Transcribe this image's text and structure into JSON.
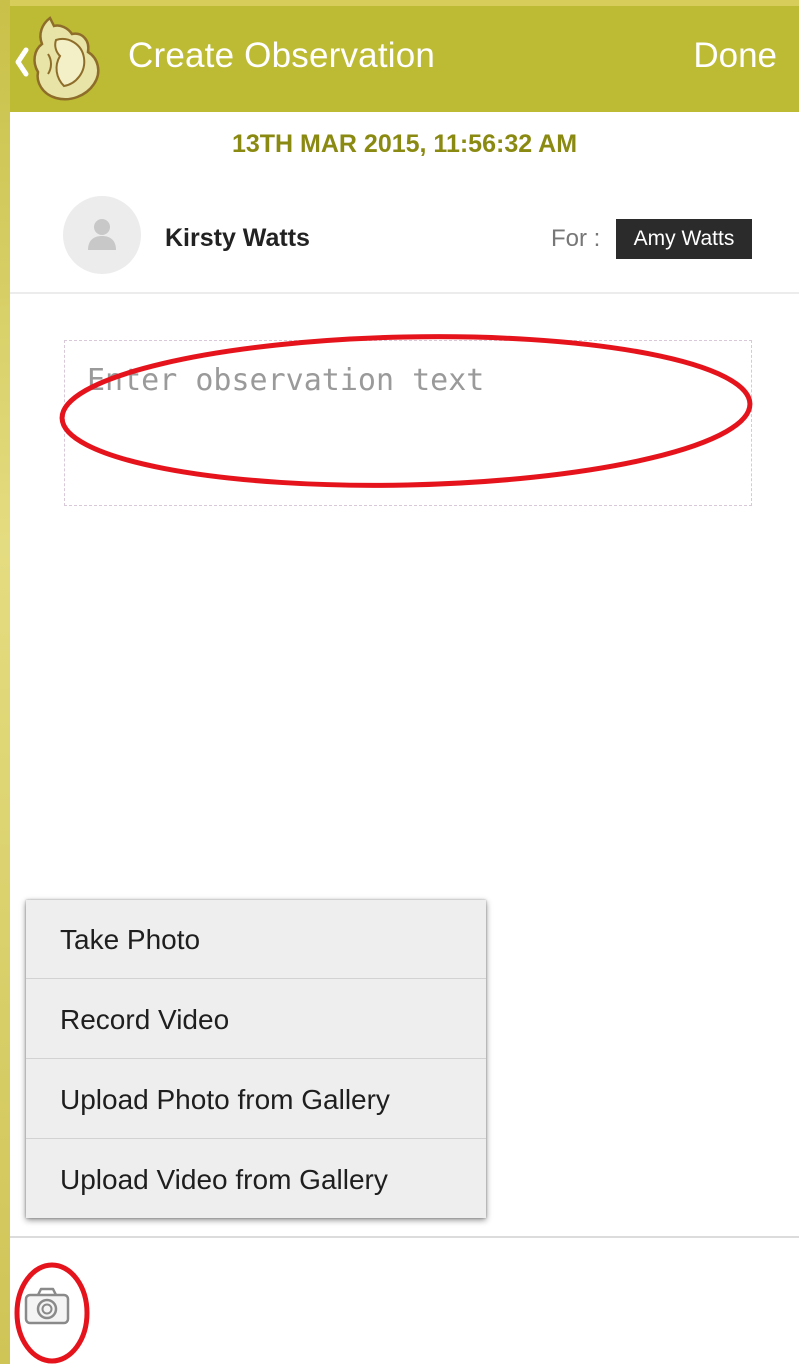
{
  "header": {
    "title": "Create Observation",
    "done_label": "Done"
  },
  "observation": {
    "timestamp": "13TH MAR 2015, 11:56:32 AM",
    "author_name": "Kirsty Watts",
    "for_label": "For :",
    "for_child": "Amy Watts",
    "text_value": "",
    "text_placeholder": "Enter observation text"
  },
  "media_menu": {
    "items": [
      {
        "label": "Take Photo"
      },
      {
        "label": "Record Video"
      },
      {
        "label": "Upload Photo from Gallery"
      },
      {
        "label": "Upload Video from Gallery"
      }
    ]
  },
  "icons": {
    "back": "chevron-left-icon",
    "logo": "app-logo-icon",
    "avatar": "user-icon",
    "camera": "camera-icon"
  },
  "colors": {
    "header_bg": "#bdbb33",
    "timestamp": "#8a8a12",
    "annotation": "#e5141c"
  }
}
